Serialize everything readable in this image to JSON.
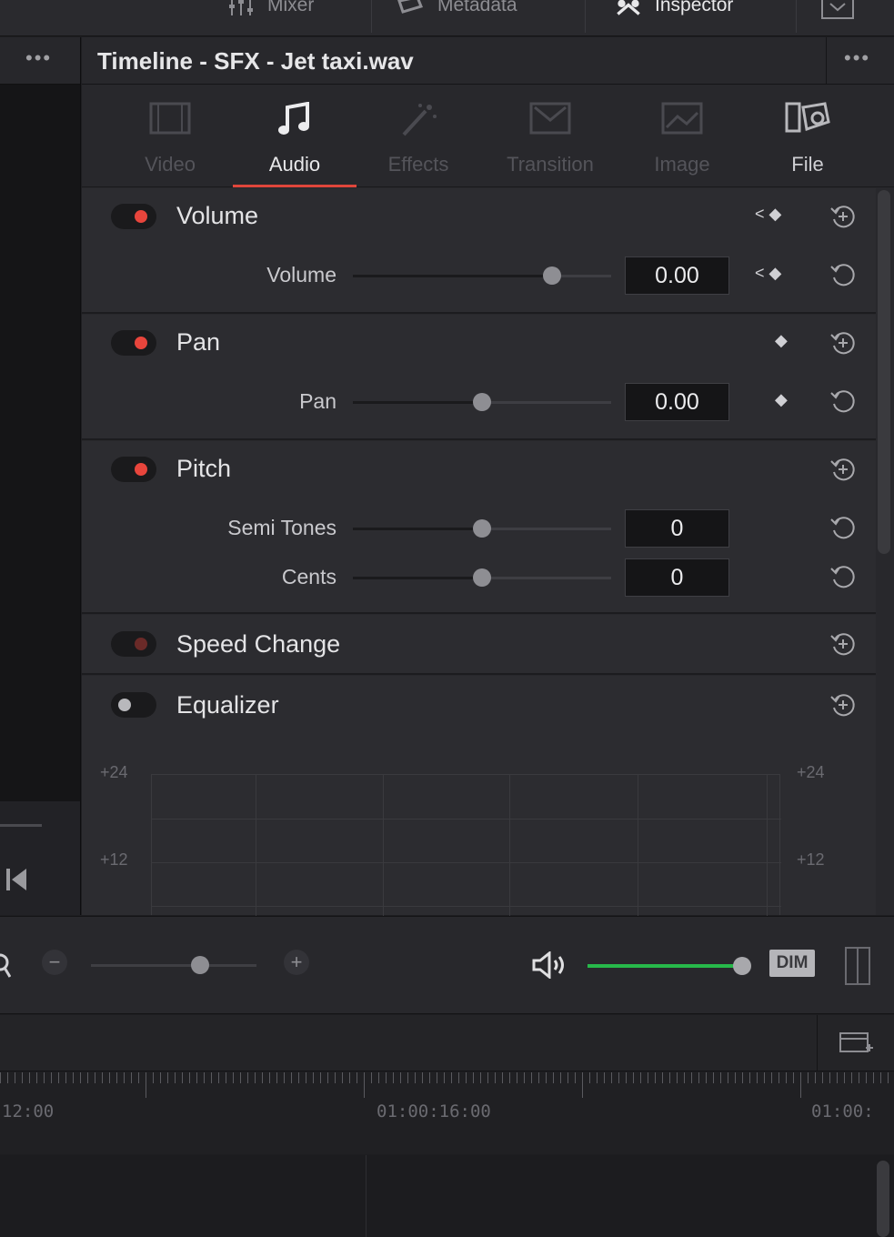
{
  "topbar": {
    "mixer_label": "Mixer",
    "metadata_label": "Metadata",
    "inspector_label": "Inspector"
  },
  "inspector": {
    "title": "Timeline - SFX - Jet taxi.wav",
    "tabs": [
      {
        "label": "Video",
        "icon": "film-icon",
        "state": "disabled"
      },
      {
        "label": "Audio",
        "icon": "music-note-icon",
        "state": "active"
      },
      {
        "label": "Effects",
        "icon": "magic-wand-icon",
        "state": "disabled"
      },
      {
        "label": "Transition",
        "icon": "transition-icon",
        "state": "disabled"
      },
      {
        "label": "Image",
        "icon": "image-icon",
        "state": "disabled"
      },
      {
        "label": "File",
        "icon": "file-icon",
        "state": "enabled"
      }
    ],
    "sections": {
      "volume": {
        "title": "Volume",
        "enabled": true,
        "params": [
          {
            "label": "Volume",
            "value": "0.00",
            "slider": 0.77
          }
        ]
      },
      "pan": {
        "title": "Pan",
        "enabled": true,
        "params": [
          {
            "label": "Pan",
            "value": "0.00",
            "slider": 0.5
          }
        ]
      },
      "pitch": {
        "title": "Pitch",
        "enabled": true,
        "params": [
          {
            "label": "Semi Tones",
            "value": "0",
            "slider": 0.5
          },
          {
            "label": "Cents",
            "value": "0",
            "slider": 0.5
          }
        ]
      },
      "speed_change": {
        "title": "Speed Change",
        "enabled": false
      },
      "equalizer": {
        "title": "Equalizer",
        "enabled": false,
        "scale_labels": [
          "+24",
          "+12"
        ]
      }
    }
  },
  "controls": {
    "zoom_level": 0.66,
    "volume_level": 0.99,
    "dim_label": "DIM",
    "minus": "−",
    "plus": "+"
  },
  "timeline": {
    "timecodes": [
      "12:00",
      "01:00:16:00",
      "01:00:"
    ]
  },
  "colors": {
    "accent": "#e0463b",
    "toggle_on": "#e8453c",
    "meter_green": "#27b84a"
  }
}
